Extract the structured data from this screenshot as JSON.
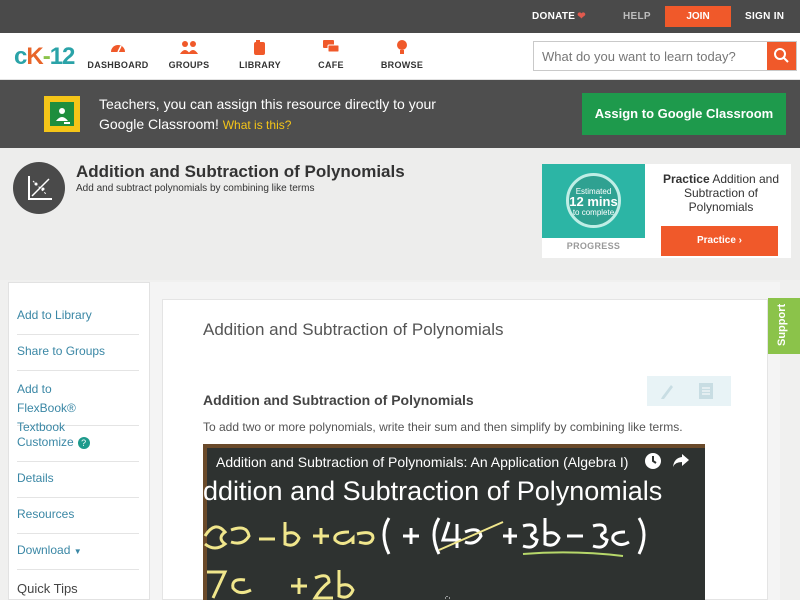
{
  "topbar": {
    "donate": "DONATE",
    "help": "HELP",
    "join": "JOIN",
    "signin": "SIGN IN"
  },
  "nav": {
    "logo": {
      "c": "c",
      "k": "K",
      "dash": "-",
      "num": "12"
    },
    "items": [
      {
        "label": "DASHBOARD",
        "icon": "dashboard-icon"
      },
      {
        "label": "GROUPS",
        "icon": "groups-icon"
      },
      {
        "label": "LIBRARY",
        "icon": "library-icon"
      },
      {
        "label": "CAFE",
        "icon": "cafe-icon"
      },
      {
        "label": "BROWSE",
        "icon": "browse-icon"
      }
    ],
    "search_placeholder": "What do you want to learn today?"
  },
  "classroom": {
    "text": "Teachers, you can assign this resource directly to your Google Classroom!",
    "what": "What is this?",
    "assign_label": "Assign to Google Classroom"
  },
  "header": {
    "title": "Addition and Subtraction of Polynomials",
    "subtitle": "Add and subtract polynomials by combining like terms"
  },
  "practice": {
    "estimated": "Estimated",
    "mins": "12 mins",
    "to_complete": "to complete",
    "progress_label": "PROGRESS",
    "title_bold": "Practice",
    "title_rest": "Addition and Subtraction of Polynomials",
    "button_label": "Practice"
  },
  "sidebar": {
    "items": [
      {
        "label": "Add to Library"
      },
      {
        "label": "Share to Groups"
      },
      {
        "label": "Add to FlexBook® Textbook"
      },
      {
        "label": "Customize"
      },
      {
        "label": "Details"
      },
      {
        "label": "Resources"
      },
      {
        "label": "Download"
      }
    ],
    "quick_tips": "Quick Tips"
  },
  "content": {
    "concept_title": "Addition and Subtraction of Polynomials",
    "section_heading": "Addition and Subtraction of Polynomials",
    "body": "To add two or more polynomials, write their sum and then simplify by combining like terms.",
    "video": {
      "title": "Addition and Subtraction of Polynomials: An Application (Algebra I)",
      "board_heading": "ddition and Subtraction of Polynomials"
    }
  },
  "support": "Support",
  "colors": {
    "accent": "#f0592a",
    "teal": "#2aa3a8",
    "green": "#1e9a4c",
    "support_green": "#8bc34a"
  }
}
